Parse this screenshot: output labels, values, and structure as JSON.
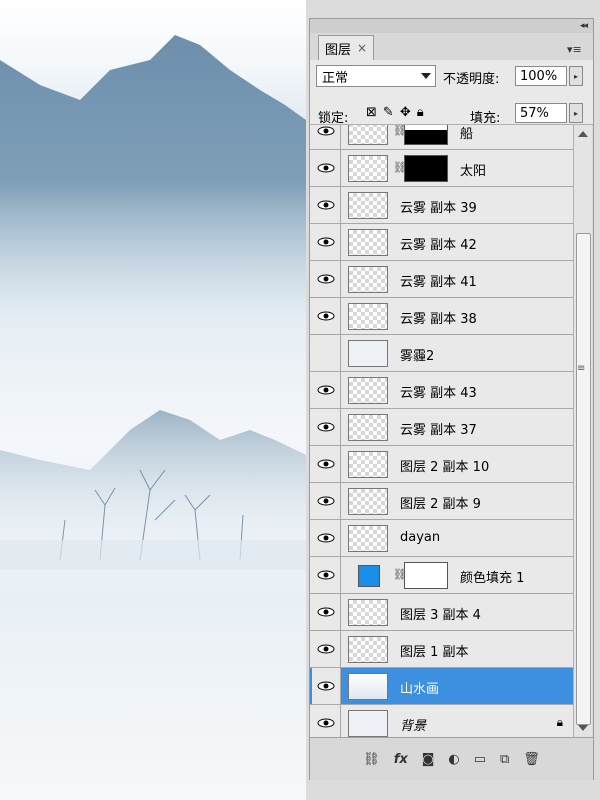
{
  "panel": {
    "tab_label": "图层",
    "tab_close": "×",
    "blend_mode": "正常",
    "opacity_label": "不透明度:",
    "opacity_value": "100%",
    "lock_label": "锁定:",
    "fill_label": "填充:",
    "fill_value": "57%"
  },
  "layers": [
    {
      "name": "船",
      "visible": true
    },
    {
      "name": "太阳",
      "visible": true
    },
    {
      "name": "云雾 副本 39",
      "visible": true
    },
    {
      "name": "云雾 副本 42",
      "visible": true
    },
    {
      "name": "云雾 副本 41",
      "visible": true
    },
    {
      "name": "云雾 副本 38",
      "visible": true
    },
    {
      "name": "雾霾2",
      "visible": false
    },
    {
      "name": "云雾 副本 43",
      "visible": true
    },
    {
      "name": "云雾 副本 37",
      "visible": true
    },
    {
      "name": "图层 2 副本 10",
      "visible": true
    },
    {
      "name": "图层 2 副本 9",
      "visible": true
    },
    {
      "name": "dayan",
      "visible": true
    },
    {
      "name": "颜色填充 1",
      "visible": true
    },
    {
      "name": "图层 3 副本 4",
      "visible": true
    },
    {
      "name": "图层 1 副本",
      "visible": true
    },
    {
      "name": "山水画",
      "visible": true,
      "selected": true
    },
    {
      "name": "背景",
      "visible": true,
      "locked": true
    }
  ],
  "colors": {
    "selection": "#3d90e0",
    "fill_swatch": "#1a8ee8"
  },
  "icons": [
    "eye-icon",
    "link-icon",
    "lock-icon",
    "fx-icon",
    "mask-icon",
    "adjustment-icon",
    "folder-icon",
    "new-layer-icon",
    "trash-icon"
  ]
}
